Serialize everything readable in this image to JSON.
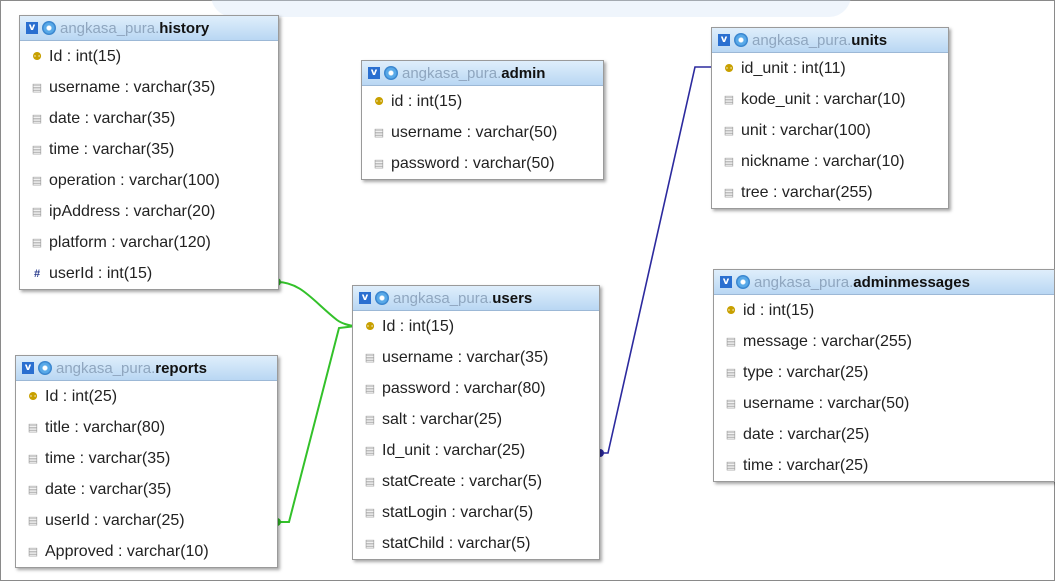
{
  "tables": [
    {
      "id": "history",
      "schema": "angkasa_pura.",
      "name": "history",
      "fields": [
        {
          "name": "Id",
          "type": "int(15)",
          "icon": "key-icon"
        },
        {
          "name": "username",
          "type": "varchar(35)",
          "icon": "column-icon"
        },
        {
          "name": "date",
          "type": "varchar(35)",
          "icon": "column-icon"
        },
        {
          "name": "time",
          "type": "varchar(35)",
          "icon": "column-icon"
        },
        {
          "name": "operation",
          "type": "varchar(100)",
          "icon": "column-icon"
        },
        {
          "name": "ipAddress",
          "type": "varchar(20)",
          "icon": "column-icon"
        },
        {
          "name": "platform",
          "type": "varchar(120)",
          "icon": "column-icon"
        },
        {
          "name": "userId",
          "type": "int(15)",
          "icon": "index-icon"
        }
      ]
    },
    {
      "id": "admin",
      "schema": "angkasa_pura.",
      "name": "admin",
      "fields": [
        {
          "name": "id",
          "type": "int(15)",
          "icon": "key-icon"
        },
        {
          "name": "username",
          "type": "varchar(50)",
          "icon": "column-icon"
        },
        {
          "name": "password",
          "type": "varchar(50)",
          "icon": "column-icon"
        }
      ]
    },
    {
      "id": "units",
      "schema": "angkasa_pura.",
      "name": "units",
      "fields": [
        {
          "name": "id_unit",
          "type": "int(11)",
          "icon": "key-icon"
        },
        {
          "name": "kode_unit",
          "type": "varchar(10)",
          "icon": "column-icon"
        },
        {
          "name": "unit",
          "type": "varchar(100)",
          "icon": "column-icon"
        },
        {
          "name": "nickname",
          "type": "varchar(10)",
          "icon": "column-icon"
        },
        {
          "name": "tree",
          "type": "varchar(255)",
          "icon": "column-icon"
        }
      ]
    },
    {
      "id": "users",
      "schema": "angkasa_pura.",
      "name": "users",
      "fields": [
        {
          "name": "Id",
          "type": "int(15)",
          "icon": "key-icon"
        },
        {
          "name": "username",
          "type": "varchar(35)",
          "icon": "column-icon"
        },
        {
          "name": "password",
          "type": "varchar(80)",
          "icon": "column-icon"
        },
        {
          "name": "salt",
          "type": "varchar(25)",
          "icon": "column-icon"
        },
        {
          "name": "Id_unit",
          "type": "varchar(25)",
          "icon": "column-icon"
        },
        {
          "name": "statCreate",
          "type": "varchar(5)",
          "icon": "column-icon"
        },
        {
          "name": "statLogin",
          "type": "varchar(5)",
          "icon": "column-icon"
        },
        {
          "name": "statChild",
          "type": "varchar(5)",
          "icon": "column-icon"
        }
      ]
    },
    {
      "id": "adminmessages",
      "schema": "angkasa_pura.",
      "name": "adminmessages",
      "fields": [
        {
          "name": "id",
          "type": "int(15)",
          "icon": "key-icon"
        },
        {
          "name": "message",
          "type": "varchar(255)",
          "icon": "column-icon"
        },
        {
          "name": "type",
          "type": "varchar(25)",
          "icon": "column-icon"
        },
        {
          "name": "username",
          "type": "varchar(50)",
          "icon": "column-icon"
        },
        {
          "name": "date",
          "type": "varchar(25)",
          "icon": "column-icon"
        },
        {
          "name": "time",
          "type": "varchar(25)",
          "icon": "column-icon"
        }
      ]
    },
    {
      "id": "reports",
      "schema": "angkasa_pura.",
      "name": "reports",
      "fields": [
        {
          "name": "Id",
          "type": "int(25)",
          "icon": "key-icon"
        },
        {
          "name": "title",
          "type": "varchar(80)",
          "icon": "column-icon"
        },
        {
          "name": "time",
          "type": "varchar(35)",
          "icon": "column-icon"
        },
        {
          "name": "date",
          "type": "varchar(35)",
          "icon": "column-icon"
        },
        {
          "name": "userId",
          "type": "varchar(25)",
          "icon": "column-icon"
        },
        {
          "name": "Approved",
          "type": "varchar(10)",
          "icon": "column-icon"
        }
      ]
    }
  ],
  "colors": {
    "link_users_related": "#33c12a",
    "link_units": "#2c2a9e",
    "header_gradient_top": "#dfeefb",
    "header_gradient_bottom": "#b9d7f3"
  },
  "relations": [
    {
      "from": "history.userId",
      "to": "users.Id"
    },
    {
      "from": "reports.userId",
      "to": "users.Id"
    },
    {
      "from": "users.Id_unit",
      "to": "units.id_unit"
    }
  ]
}
